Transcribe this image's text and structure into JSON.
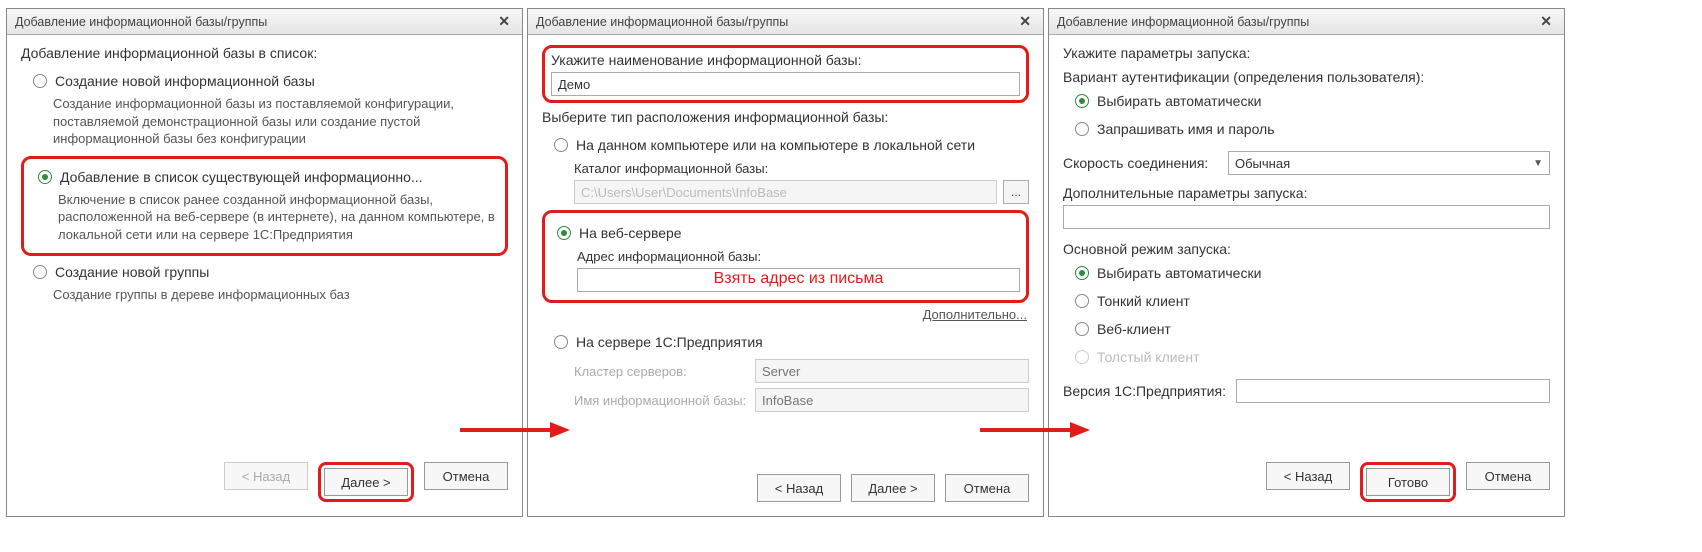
{
  "title": "Добавление информационной базы/группы",
  "close_glyph": "✕",
  "d1": {
    "heading": "Добавление информационной базы в список:",
    "opt1_label": "Создание новой информационной базы",
    "opt1_desc": "Создание информационной базы из поставляемой конфигурации, поставляемой демонстрационной базы или создание пустой информационной базы без конфигурации",
    "opt2_label": "Добавление в список существующей информационно...",
    "opt2_desc": "Включение в список ранее созданной информационной базы, расположенной на веб-сервере (в интернете), на данном компьютере,  в локальной сети или на сервере 1С:Предприятия",
    "opt3_label": "Создание новой группы",
    "opt3_desc": "Создание группы в дереве информационных баз",
    "back": "< Назад",
    "next": "Далее >",
    "cancel": "Отмена"
  },
  "d2": {
    "name_label": "Укажите наименование информационной базы:",
    "name_value": "Демо",
    "type_label": "Выберите тип расположения информационной базы:",
    "opt_local": "На данном компьютере или на компьютере в локальной сети",
    "catalog_label": "Каталог информационной базы:",
    "catalog_value": "C:\\Users\\User\\Documents\\InfoBase",
    "dots": "...",
    "opt_web": "На веб-сервере",
    "web_addr_label": "Адрес информационной базы:",
    "web_addr_hint": "Взять адрес из письма",
    "advanced": "Дополнительно...",
    "opt_server": "На сервере 1С:Предприятия",
    "cluster_label": "Кластер серверов:",
    "cluster_value": "Server",
    "ibname_label": "Имя информационной базы:",
    "ibname_value": "InfoBase",
    "back": "< Назад",
    "next": "Далее >",
    "cancel": "Отмена"
  },
  "d3": {
    "heading": "Укажите параметры запуска:",
    "auth_label": "Вариант аутентификации (определения пользователя):",
    "auth_auto": "Выбирать автоматически",
    "auth_ask": "Запрашивать имя и пароль",
    "speed_label": "Скорость соединения:",
    "speed_value": "Обычная",
    "params_label": "Дополнительные параметры запуска:",
    "mode_label": "Основной режим запуска:",
    "mode_auto": "Выбирать автоматически",
    "mode_thin": "Тонкий клиент",
    "mode_web": "Веб-клиент",
    "mode_thick": "Толстый клиент",
    "version_label": "Версия 1С:Предприятия:",
    "back": "< Назад",
    "done": "Готово",
    "cancel": "Отмена"
  }
}
